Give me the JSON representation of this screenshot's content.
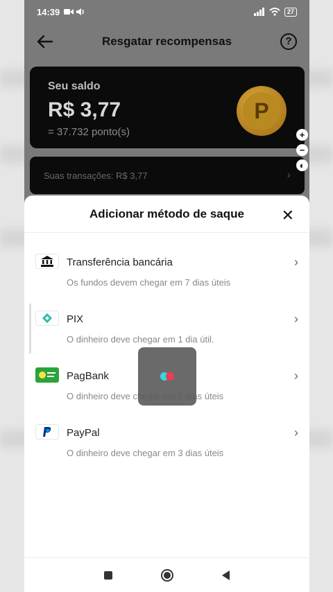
{
  "status_bar": {
    "time": "14:39",
    "battery": "27"
  },
  "header": {
    "title": "Resgatar recompensas",
    "back_icon": "arrow-left-icon",
    "help_icon": "question-circle-icon",
    "help_glyph": "?"
  },
  "balance": {
    "label": "Seu saldo",
    "amount": "R$ 3,77",
    "points": "= 37.732 ponto(s)",
    "coin_letter": "P"
  },
  "transactions": {
    "label": "Suas transações: R$ 3,77"
  },
  "zoom": [
    "+",
    "−",
    "◐"
  ],
  "sheet": {
    "title": "Adicionar método de saque",
    "close_glyph": "✕",
    "methods": [
      {
        "name": "Transferência bancária",
        "desc": "Os fundos devem chegar em 7 dias úteis",
        "icon": "bank-icon"
      },
      {
        "name": "PIX",
        "desc": "O dinheiro deve chegar em 1 dia útil.",
        "icon": "pix-icon"
      },
      {
        "name": "PagBank",
        "desc": "O dinheiro deve chegar em 2 dias úteis",
        "icon": "pagbank-icon"
      },
      {
        "name": "PayPal",
        "desc": "O dinheiro deve chegar em 3 dias úteis",
        "icon": "paypal-icon"
      }
    ]
  },
  "colors": {
    "accent_cyan": "#35d7e0",
    "accent_red": "#f03a57",
    "pagbank_green": "#2aa43a",
    "pix_teal": "#32bcad",
    "paypal_blue": "#003087"
  }
}
